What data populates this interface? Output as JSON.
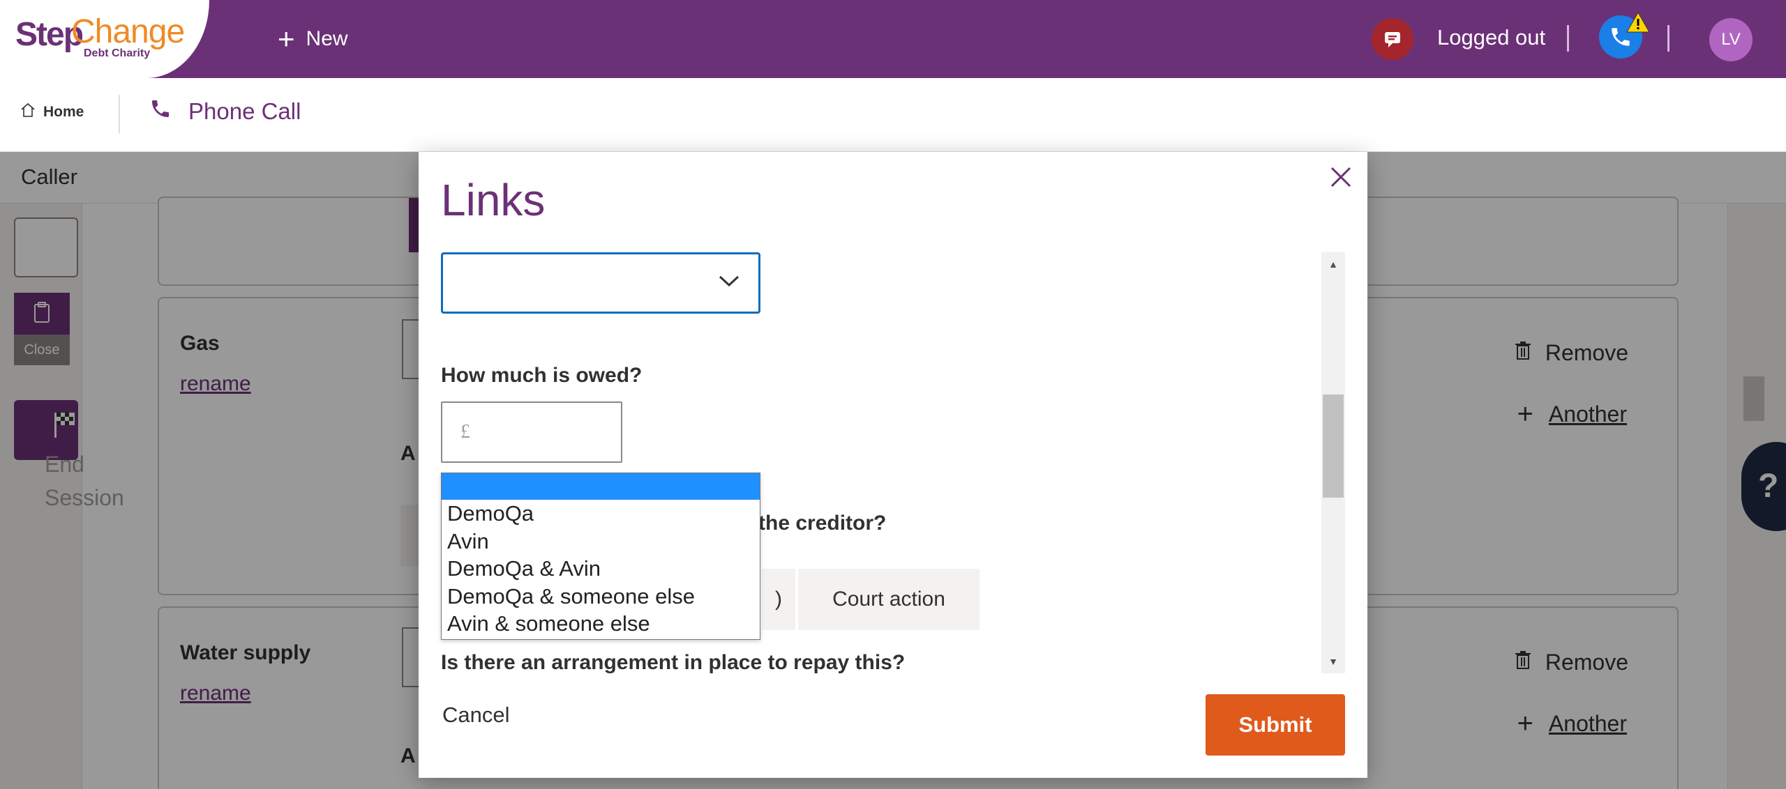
{
  "header": {
    "logo_step": "Step",
    "logo_change": "Change",
    "logo_sub": "Debt Charity",
    "new_label": "New",
    "status_text": "Logged out",
    "avatar_initials": "LV"
  },
  "subnav": {
    "home_label": "Home",
    "phone_call_label": "Phone Call"
  },
  "background": {
    "caller_label": "Caller",
    "rail_close_label": "Close",
    "rail_end_text": [
      "End",
      "Session"
    ],
    "cards": [
      {
        "title": "Gas",
        "rename": "rename",
        "remove": "Remove",
        "another": "Another"
      },
      {
        "title": "Water supply",
        "rename": "rename",
        "remove": "Remove",
        "another": "Another"
      }
    ],
    "help_label": "?"
  },
  "dialog": {
    "title": "Links",
    "select_value": "",
    "how_much_label": "How much is owed?",
    "money_placeholder": "£",
    "creditor_question_visible": "y the creditor?",
    "pill_partial": ")",
    "pill_court": "Court action",
    "arrangement_label": "Is there an arrangement in place to repay this?",
    "cancel_label": "Cancel",
    "submit_label": "Submit",
    "dropdown_options": [
      "",
      "DemoQa",
      "Avin",
      "DemoQa & Avin",
      "DemoQa & someone else",
      "Avin & someone else"
    ]
  },
  "colors": {
    "brand_purple": "#6b3176",
    "brand_orange": "#f08a24",
    "submit_orange": "#e05a1b",
    "focus_blue": "#0f6cbd",
    "selected_option_blue": "#1e90ff"
  },
  "icons": [
    "plus-icon",
    "chat-icon",
    "phone-icon",
    "warning-icon",
    "home-icon",
    "phone-call-icon",
    "close-icon",
    "chevron-down-icon",
    "trash-icon",
    "clipboard-icon",
    "flag-icon"
  ]
}
